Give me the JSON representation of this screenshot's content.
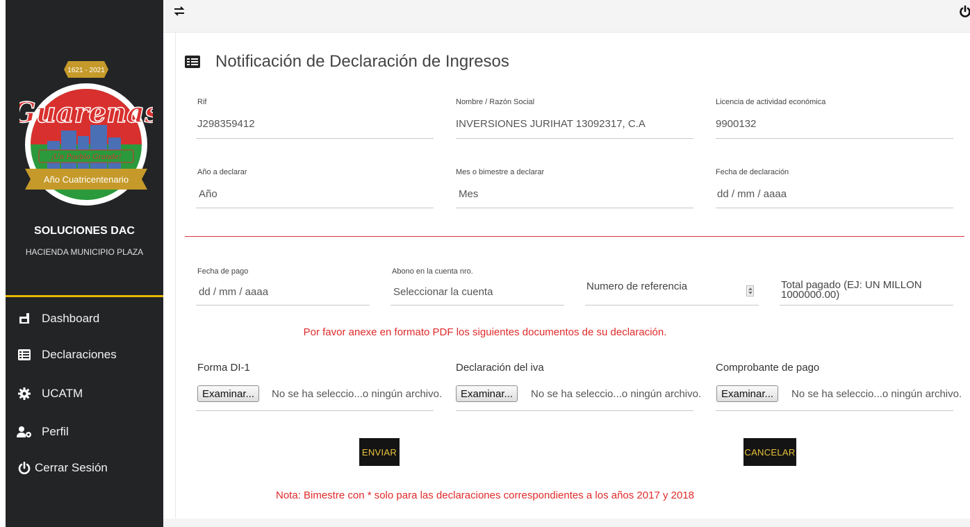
{
  "sidebar": {
    "logo": {
      "text": "Guarenas",
      "years": "1621 - 2021",
      "slogan": "¡Un Pueblo Grande!",
      "ribbon": "Año Cuatricentenario"
    },
    "title": "SOLUCIONES DAC",
    "subtitle": "HACIENDA MUNICIPIO PLAZA",
    "nav": [
      {
        "label": "Dashboard",
        "icon": "dashboard-icon"
      },
      {
        "label": "Declaraciones",
        "icon": "list-icon"
      },
      {
        "label": "UCATM",
        "icon": "gear-icon"
      },
      {
        "label": "Perfil",
        "icon": "user-gear-icon"
      },
      {
        "label": "Cerrar Sesión",
        "icon": "power-icon"
      }
    ],
    "accent_color": "#e6b800"
  },
  "page": {
    "title": "Notificación de Declaración de Ingresos"
  },
  "form": {
    "rif": {
      "label": "Rif",
      "value": "J298359412"
    },
    "nombre": {
      "label": "Nombre / Razón Social",
      "value": "INVERSIONES JURIHAT 13092317, C.A"
    },
    "licencia": {
      "label": "Licencia de actividad económica",
      "value": "9900132"
    },
    "anio": {
      "label": "Año a declarar",
      "value": "Año"
    },
    "mes": {
      "label": "Mes o bimestre a declarar",
      "value": "Mes"
    },
    "fecha_declaracion": {
      "label": "Fecha de declaración",
      "value": "dd / mm / aaaa"
    },
    "fecha_pago": {
      "label": "Fecha de pago",
      "value": "dd / mm / aaaa"
    },
    "abono": {
      "label": "Abono en la cuenta nro.",
      "value": "Seleccionar la cuenta"
    },
    "referencia": {
      "placeholder": "Numero de referencia"
    },
    "total": {
      "placeholder": "Total pagado (EJ: UN MILLON 1000000.00)"
    }
  },
  "attachments": {
    "notice": "Por favor anexe en formato PDF los siguientes documentos de su declaración.",
    "items": [
      {
        "label": "Forma DI-1",
        "button": "Examinar...",
        "status": "No se ha seleccio...o ningún archivo."
      },
      {
        "label": "Declaración del iva",
        "button": "Examinar...",
        "status": "No se ha seleccio...o ningún archivo."
      },
      {
        "label": "Comprobante de pago",
        "button": "Examinar...",
        "status": "No se ha seleccio...o ningún archivo."
      }
    ]
  },
  "actions": {
    "send": "ENVIAR",
    "cancel": "CANCELAR"
  },
  "note": "Nota: Bimestre con * solo para las declaraciones correspondientes a los años 2017 y 2018",
  "colors": {
    "sidebar_bg": "#232426",
    "error_red": "#e02a2a",
    "button_bg": "#141414",
    "button_text": "#e8c23a"
  }
}
